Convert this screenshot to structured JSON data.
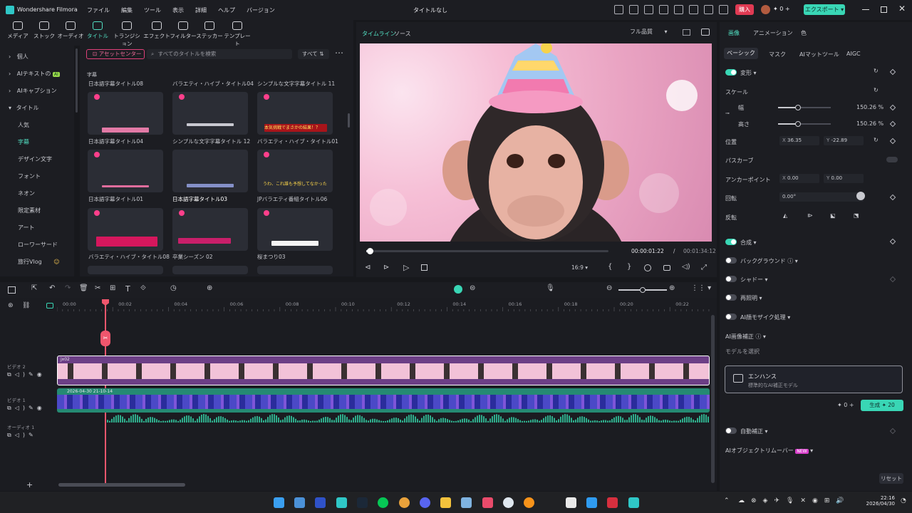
{
  "app": {
    "name": "Wondershare Filmora",
    "project_title": "タイトルなし",
    "menu": [
      "ファイル",
      "編集",
      "ツール",
      "表示",
      "詳細",
      "ヘルプ",
      "バージョン"
    ],
    "join_button": "購入",
    "credits": "0",
    "export_button": "エクスポート"
  },
  "asset_tabs": [
    {
      "label": "メディア",
      "icon": "media-icon"
    },
    {
      "label": "ストック",
      "icon": "stock-icon"
    },
    {
      "label": "オーディオ",
      "icon": "audio-icon"
    },
    {
      "label": "タイトル",
      "icon": "title-icon",
      "active": true
    },
    {
      "label": "トランジション",
      "icon": "transition-icon"
    },
    {
      "label": "エフェクト",
      "icon": "effect-icon"
    },
    {
      "label": "フィルター",
      "icon": "filter-icon"
    },
    {
      "label": "ステッカー",
      "icon": "sticker-icon"
    },
    {
      "label": "テンプレート",
      "icon": "template-icon"
    }
  ],
  "sidebar": {
    "items": [
      {
        "label": "個人",
        "level": 0
      },
      {
        "label": "AIテキストの",
        "level": 0,
        "badge": "AI"
      },
      {
        "label": "AIキャプション",
        "level": 0
      },
      {
        "label": "タイトル",
        "level": 0,
        "expanded": true
      },
      {
        "label": "人気",
        "level": 1
      },
      {
        "label": "字幕",
        "level": 1,
        "active": true
      },
      {
        "label": "デザイン文字",
        "level": 1
      },
      {
        "label": "フォント",
        "level": 1
      },
      {
        "label": "ネオン",
        "level": 1
      },
      {
        "label": "限定素材",
        "level": 1
      },
      {
        "label": "アート",
        "level": 1
      },
      {
        "label": "ローワーサード",
        "level": 1
      },
      {
        "label": "旅行Vlog",
        "level": 1
      }
    ]
  },
  "library": {
    "asset_center": "アセットセンター",
    "search_placeholder": "すべてのタイトルを検索",
    "filter_label": "すべて",
    "section": "字幕",
    "row_labels_top": [
      "日本語字幕タイトル08",
      "バラエティ・ハイブ・タイトル04",
      "シンプルな文字字幕タイトル 11"
    ],
    "card_text_1": "本気挑戦でまさかの結果！？",
    "card_text_2": "うわ、これ誰も予想してなかった！",
    "cards": [
      {
        "label": "日本語字幕タイトル04"
      },
      {
        "label": "シンプルな文字字幕タイトル 12"
      },
      {
        "label": "バラエティ・ハイブ・タイトル01"
      },
      {
        "label": "日本語字幕タイトル01"
      },
      {
        "label": "日本語字幕タイトル03"
      },
      {
        "label": "JPバラエティ番組タイトル06"
      },
      {
        "label": "バラエティ・ハイブ・タイトル08"
      },
      {
        "label": "卒業シーズン 02"
      },
      {
        "label": "桜まつり03"
      }
    ]
  },
  "preview": {
    "tabs": [
      "タイムライン",
      "ソース"
    ],
    "quality": "フル品質",
    "current_time": "00:00:01:22",
    "total_time": "00:01:34:12",
    "aspect": "16:9",
    "progress": 0.03
  },
  "props": {
    "tabs": [
      "画像",
      "アニメーション",
      "色"
    ],
    "subtabs": [
      "ベーシック",
      "マスク",
      "AIマットツール",
      "AIGC"
    ],
    "transform": "変形",
    "scale": "スケール",
    "width_label": "幅",
    "height_label": "高さ",
    "width_value": "150.26",
    "height_value": "150.26",
    "scale_percent": "%",
    "position": "位置",
    "pos_x": "36.35",
    "pos_y": "-22.89",
    "path_curve": "パスカーブ",
    "anchor": "アンカーポイント",
    "anchor_x": "0.00",
    "anchor_y": "0.00",
    "rotate": "回転",
    "rotate_value": "0.00°",
    "flip": "反転",
    "composite": "合成",
    "background": "バックグラウンド",
    "shadow": "シャドー",
    "reflection": "再照明",
    "ai_mosaic": "AI顔モザイク処理",
    "ai_enhance": "AI画像補正",
    "select_model": "モデルを選択",
    "model_name": "エンハンス",
    "model_desc": "標準的なAI補正モデル",
    "credits": "0",
    "generate_button": "生成",
    "generate_cost": "20",
    "auto_enhance": "自動補正",
    "object_remover": "AIオブジェクトリムーバー",
    "new_badge": "NEW",
    "reset_button": "リセット"
  },
  "timeline": {
    "ruler": [
      "00:00",
      "00:02",
      "00:04",
      "00:06",
      "00:08",
      "00:10",
      "00:12",
      "00:14",
      "00:16",
      "00:18",
      "00:20",
      "00:22"
    ],
    "tracks": [
      {
        "name": "ビデオ 2",
        "clip": "jx02"
      },
      {
        "name": "ビデオ 1",
        "clip": "2026-04-30 21-10-14"
      },
      {
        "name": "オーディオ 1"
      }
    ]
  },
  "taskbar": {
    "time": "22:16",
    "date": "2026/04/30"
  }
}
